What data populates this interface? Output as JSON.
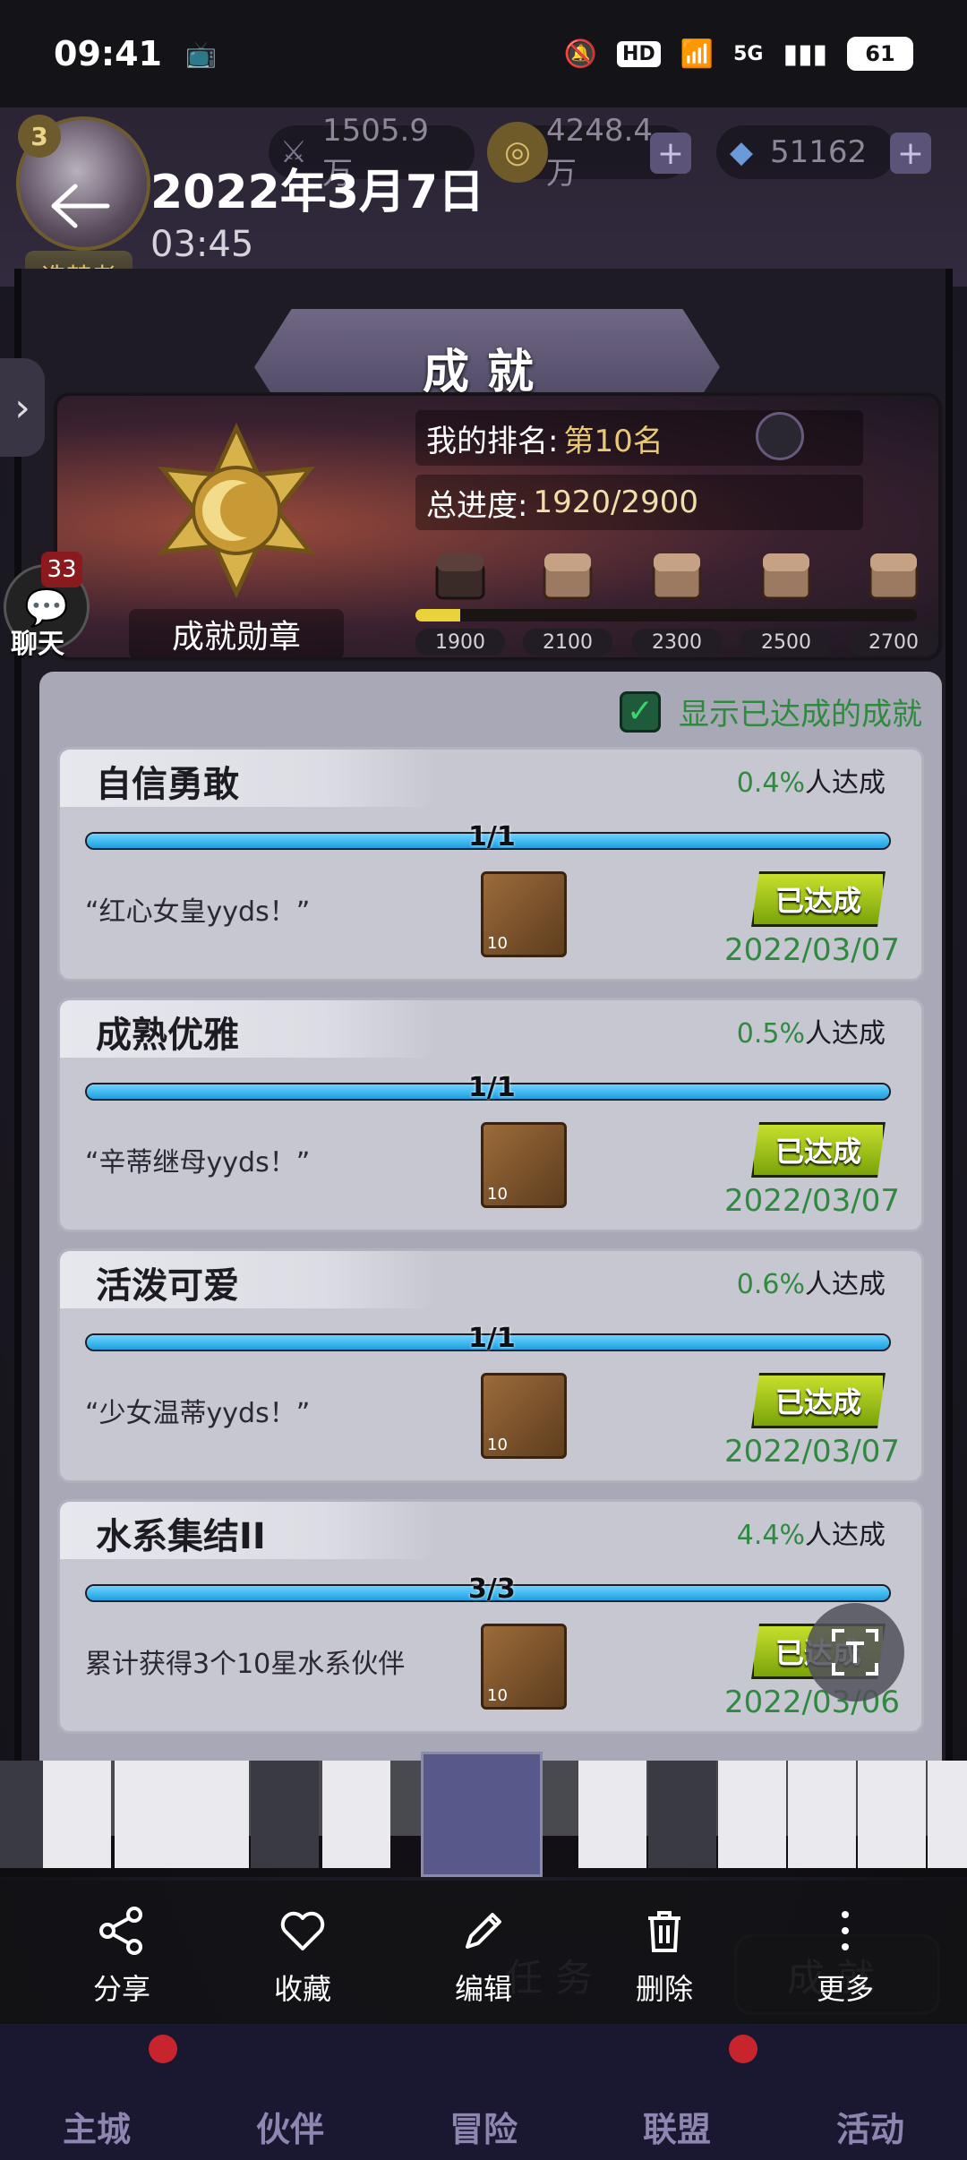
{
  "status": {
    "time": "09:41",
    "hd": "HD",
    "network": "5G",
    "battery": "61"
  },
  "resources": {
    "stamina": "1505.9万",
    "gold": "4248.4万",
    "gems": "51162",
    "level": "3",
    "title_badge": "造梦者"
  },
  "viewer": {
    "date": "2022年3月7日",
    "time": "03:45"
  },
  "panel": {
    "title": "成就",
    "medal_label": "成就勋章",
    "rank_label": "我的排名:",
    "rank_value": "第10名",
    "progress_label": "总进度:",
    "progress_value": "1920/2900",
    "progress_fraction": 0.09,
    "milestones": [
      "1900",
      "2100",
      "2300",
      "2500",
      "2700"
    ]
  },
  "toggle": {
    "label": "显示已达成的成就",
    "checked": true
  },
  "achievements": [
    {
      "title": "自信勇敢",
      "rate_pct": "0.4%",
      "rate_suffix": "人达成",
      "progress": "1/1",
      "fill": 1.0,
      "desc": "“红心女皇yyds！”",
      "reward": "10",
      "stamp": "已达成",
      "date": "2022/03/07"
    },
    {
      "title": "成熟优雅",
      "rate_pct": "0.5%",
      "rate_suffix": "人达成",
      "progress": "1/1",
      "fill": 1.0,
      "desc": "“辛蒂继母yyds！”",
      "reward": "10",
      "stamp": "已达成",
      "date": "2022/03/07"
    },
    {
      "title": "活泼可爱",
      "rate_pct": "0.6%",
      "rate_suffix": "人达成",
      "progress": "1/1",
      "fill": 1.0,
      "desc": "“少女温蒂yyds！”",
      "reward": "10",
      "stamp": "已达成",
      "date": "2022/03/07"
    },
    {
      "title": "水系集结II",
      "rate_pct": "4.4%",
      "rate_suffix": "人达成",
      "progress": "3/3",
      "fill": 1.0,
      "desc": "累计获得3个10星水系伙伴",
      "reward": "10",
      "stamp": "已达成",
      "date": "2022/03/06"
    }
  ],
  "chat": {
    "label": "聊天",
    "count": "33"
  },
  "under_buttons": {
    "task": "任务",
    "achievement": "成就"
  },
  "actions": [
    {
      "label": "分享",
      "icon": "share-icon"
    },
    {
      "label": "收藏",
      "icon": "heart-icon"
    },
    {
      "label": "编辑",
      "icon": "pencil-icon"
    },
    {
      "label": "删除",
      "icon": "trash-icon"
    },
    {
      "label": "更多",
      "icon": "more-icon"
    }
  ],
  "game_nav": [
    "主城",
    "伙伴",
    "冒险",
    "联盟",
    "活动"
  ]
}
